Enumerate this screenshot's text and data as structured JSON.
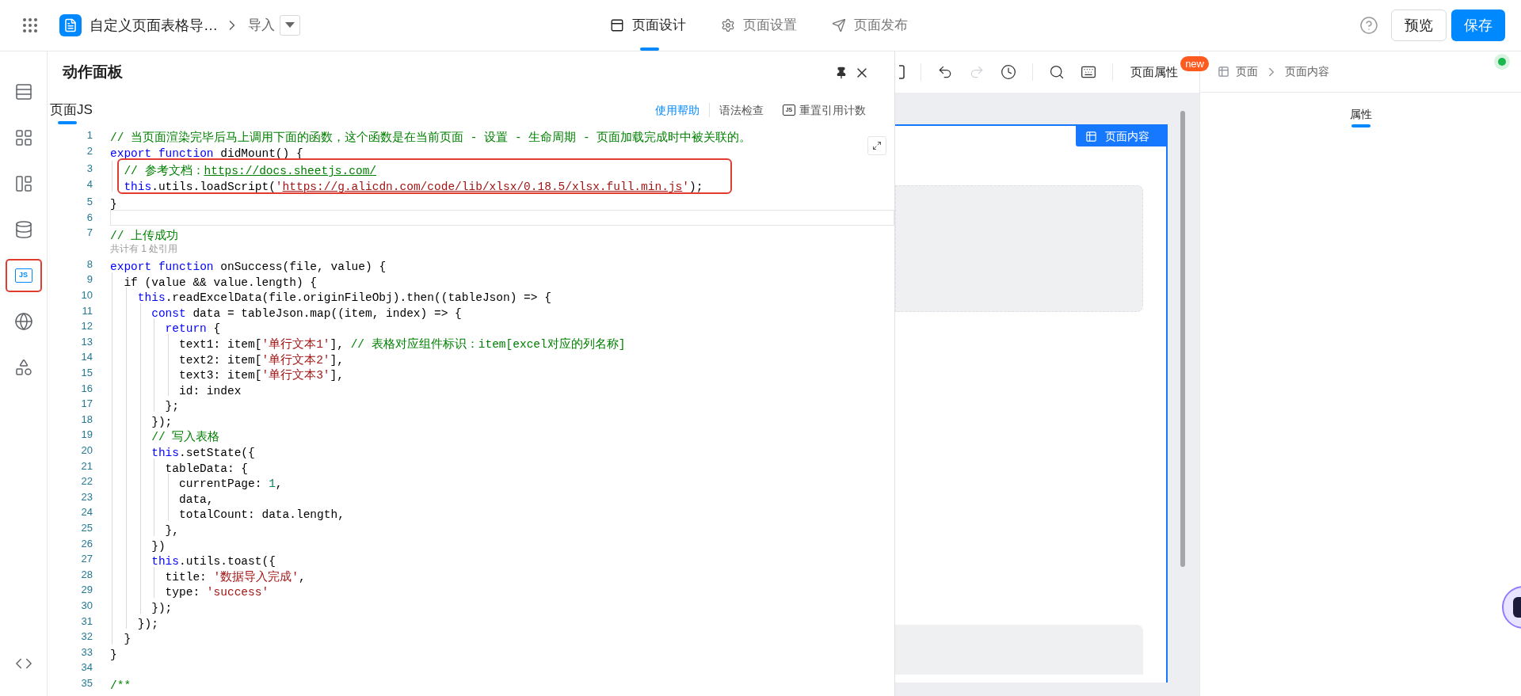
{
  "topbar": {
    "app_title": "自定义页面表格导…",
    "breadcrumb_item": "导入",
    "tabs": [
      {
        "kind": "design",
        "label": "页面设计",
        "selected": true
      },
      {
        "kind": "settings",
        "label": "页面设置",
        "selected": false
      },
      {
        "kind": "publish",
        "label": "页面发布",
        "selected": false
      }
    ],
    "preview_button": "预览",
    "save_button": "保存"
  },
  "left_rail": [
    {
      "kind": "outline",
      "highlighted": false
    },
    {
      "kind": "components",
      "highlighted": false
    },
    {
      "kind": "layout",
      "highlighted": false
    },
    {
      "kind": "datasource",
      "highlighted": false
    },
    {
      "kind": "js",
      "label": "JS",
      "highlighted": true
    },
    {
      "kind": "globe",
      "highlighted": false
    },
    {
      "kind": "apps",
      "highlighted": false
    }
  ],
  "action_panel": {
    "title": "动作面板",
    "tab": {
      "label": "页面JS",
      "selected": true
    },
    "help_link": "使用帮助",
    "lint_link": "语法检查",
    "reset_badge": "JS",
    "reset_link": "重置引用计数",
    "lines": [
      {
        "kind": "code",
        "number": "1",
        "tokens": [
          {
            "kind": "comment",
            "text": "// 当页面渲染完毕后马上调用下面的函数，这个函数是在当前页面 - 设置 - 生命周期 - 页面加载完成时中被关联的。"
          }
        ]
      },
      {
        "kind": "code",
        "number": "2",
        "tokens": [
          {
            "kind": "keyword",
            "text": "export"
          },
          {
            "kind": "keyword",
            "text": " function"
          },
          {
            "kind": "plain",
            "text": " didMount() {"
          }
        ]
      },
      {
        "kind": "code",
        "number": "3",
        "highlighted": true,
        "tokens": [
          {
            "kind": "comment",
            "text": "  // 参考文档："
          },
          {
            "kind": "comment_link",
            "text": "https://docs.sheetjs.com/"
          }
        ]
      },
      {
        "kind": "code",
        "number": "4",
        "highlighted": true,
        "tokens": [
          {
            "kind": "keyword",
            "text": "  this"
          },
          {
            "kind": "plain",
            "text": ".utils.loadScript("
          },
          {
            "kind": "string",
            "text": "'"
          },
          {
            "kind": "string_link",
            "text": "https://g.alicdn.com/code/lib/xlsx/0.18.5/xlsx.full.min.js"
          },
          {
            "kind": "string",
            "text": "'"
          },
          {
            "kind": "plain",
            "text": ");"
          }
        ]
      },
      {
        "kind": "code",
        "number": "5",
        "tokens": [
          {
            "kind": "plain",
            "text": "}"
          }
        ]
      },
      {
        "kind": "code",
        "number": "6",
        "current": true
      },
      {
        "kind": "code",
        "number": "7",
        "tokens": [
          {
            "kind": "comment",
            "text": "// 上传成功"
          }
        ]
      },
      {
        "kind": "lens",
        "text": "共计有 1 处引用"
      },
      {
        "kind": "code",
        "number": "8",
        "tokens": [
          {
            "kind": "keyword",
            "text": "export"
          },
          {
            "kind": "keyword",
            "text": " function"
          },
          {
            "kind": "plain",
            "text": " onSuccess(file, value) {"
          }
        ]
      },
      {
        "kind": "code",
        "number": "9",
        "tokens": [
          {
            "kind": "plain",
            "text": "  if (value && value.length) {"
          }
        ]
      },
      {
        "kind": "code",
        "number": "10",
        "tokens": [
          {
            "kind": "keyword",
            "text": "    this"
          },
          {
            "kind": "plain",
            "text": ".readExcelData(file.originFileObj).then((tableJson) => {"
          }
        ]
      },
      {
        "kind": "code",
        "number": "11",
        "tokens": [
          {
            "kind": "keyword",
            "text": "      const"
          },
          {
            "kind": "plain",
            "text": " data = tableJson.map((item, index) => {"
          }
        ]
      },
      {
        "kind": "code",
        "number": "12",
        "tokens": [
          {
            "kind": "keyword",
            "text": "        return"
          },
          {
            "kind": "plain",
            "text": " {"
          }
        ]
      },
      {
        "kind": "code",
        "number": "13",
        "tokens": [
          {
            "kind": "plain",
            "text": "          text1: item["
          },
          {
            "kind": "string",
            "text": "'单行文本1'"
          },
          {
            "kind": "plain",
            "text": "],"
          },
          {
            "kind": "comment",
            "text": " // 表格对应组件标识：item[excel对应的列名称]"
          }
        ]
      },
      {
        "kind": "code",
        "number": "14",
        "tokens": [
          {
            "kind": "plain",
            "text": "          text2: item["
          },
          {
            "kind": "string",
            "text": "'单行文本2'"
          },
          {
            "kind": "plain",
            "text": "],"
          }
        ]
      },
      {
        "kind": "code",
        "number": "15",
        "tokens": [
          {
            "kind": "plain",
            "text": "          text3: item["
          },
          {
            "kind": "string",
            "text": "'单行文本3'"
          },
          {
            "kind": "plain",
            "text": "],"
          }
        ]
      },
      {
        "kind": "code",
        "number": "16",
        "tokens": [
          {
            "kind": "plain",
            "text": "          id: index"
          }
        ]
      },
      {
        "kind": "code",
        "number": "17",
        "tokens": [
          {
            "kind": "plain",
            "text": "        };"
          }
        ]
      },
      {
        "kind": "code",
        "number": "18",
        "tokens": [
          {
            "kind": "plain",
            "text": "      });"
          }
        ]
      },
      {
        "kind": "code",
        "number": "19",
        "tokens": [
          {
            "kind": "comment",
            "text": "      // 写入表格"
          }
        ]
      },
      {
        "kind": "code",
        "number": "20",
        "tokens": [
          {
            "kind": "keyword",
            "text": "      this"
          },
          {
            "kind": "plain",
            "text": ".setState({"
          }
        ]
      },
      {
        "kind": "code",
        "number": "21",
        "tokens": [
          {
            "kind": "plain",
            "text": "        tableData: {"
          }
        ]
      },
      {
        "kind": "code",
        "number": "22",
        "tokens": [
          {
            "kind": "plain",
            "text": "          currentPage: "
          },
          {
            "kind": "number",
            "text": "1"
          },
          {
            "kind": "plain",
            "text": ","
          }
        ]
      },
      {
        "kind": "code",
        "number": "23",
        "tokens": [
          {
            "kind": "plain",
            "text": "          data,"
          }
        ]
      },
      {
        "kind": "code",
        "number": "24",
        "tokens": [
          {
            "kind": "plain",
            "text": "          totalCount: data.length,"
          }
        ]
      },
      {
        "kind": "code",
        "number": "25",
        "tokens": [
          {
            "kind": "plain",
            "text": "        },"
          }
        ]
      },
      {
        "kind": "code",
        "number": "26",
        "tokens": [
          {
            "kind": "plain",
            "text": "      })"
          }
        ]
      },
      {
        "kind": "code",
        "number": "27",
        "tokens": [
          {
            "kind": "keyword",
            "text": "      this"
          },
          {
            "kind": "plain",
            "text": ".utils.toast({"
          }
        ]
      },
      {
        "kind": "code",
        "number": "28",
        "tokens": [
          {
            "kind": "plain",
            "text": "        title: "
          },
          {
            "kind": "string",
            "text": "'数据导入完成'"
          },
          {
            "kind": "plain",
            "text": ","
          }
        ]
      },
      {
        "kind": "code",
        "number": "29",
        "tokens": [
          {
            "kind": "plain",
            "text": "        type: "
          },
          {
            "kind": "string",
            "text": "'success'"
          }
        ]
      },
      {
        "kind": "code",
        "number": "30",
        "tokens": [
          {
            "kind": "plain",
            "text": "      });"
          }
        ]
      },
      {
        "kind": "code",
        "number": "31",
        "tokens": [
          {
            "kind": "plain",
            "text": "    });"
          }
        ]
      },
      {
        "kind": "code",
        "number": "32",
        "tokens": [
          {
            "kind": "plain",
            "text": "  }"
          }
        ]
      },
      {
        "kind": "code",
        "number": "33",
        "tokens": [
          {
            "kind": "plain",
            "text": "}"
          }
        ]
      },
      {
        "kind": "code",
        "number": "34"
      },
      {
        "kind": "code",
        "number": "35",
        "tokens": [
          {
            "kind": "comment",
            "text": "/**"
          }
        ]
      }
    ]
  },
  "canvas": {
    "toolbar": [
      {
        "kind": "partial"
      },
      {
        "kind": "divider"
      },
      {
        "kind": "undo"
      },
      {
        "kind": "redo",
        "disabled": true
      },
      {
        "kind": "history"
      },
      {
        "kind": "divider"
      },
      {
        "kind": "search"
      },
      {
        "kind": "keyboard"
      },
      {
        "kind": "divider"
      }
    ],
    "page_props": "页面属性",
    "page_props_badge": "new",
    "page_tag": "页面内容"
  },
  "right_panel": {
    "breadcrumb": [
      "页面",
      "页面内容"
    ],
    "tab": {
      "label": "属性",
      "selected": true
    }
  }
}
